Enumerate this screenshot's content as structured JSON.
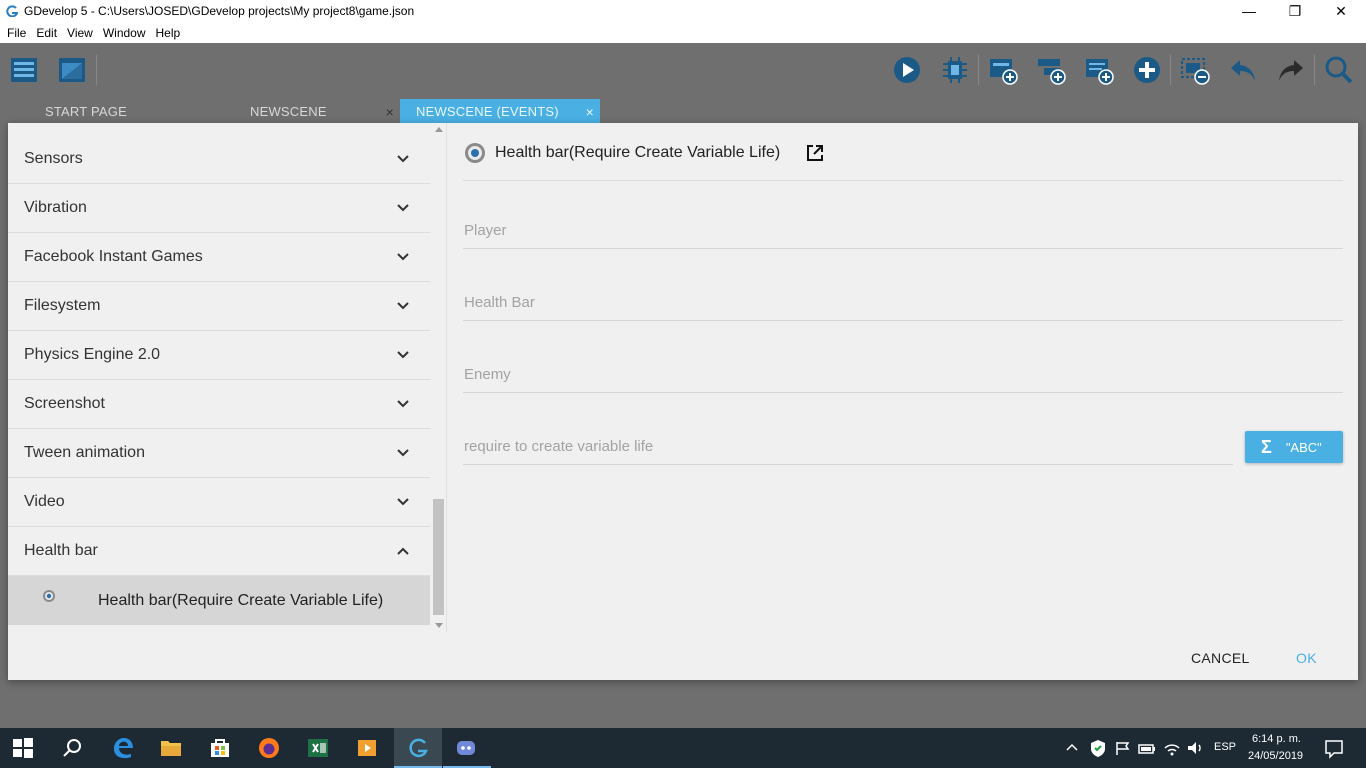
{
  "window": {
    "title": "GDevelop 5 - C:\\Users\\JOSED\\GDevelop projects\\My project8\\game.json",
    "minimize": "—",
    "restore": "❐",
    "close": "✕"
  },
  "menu": [
    "File",
    "Edit",
    "View",
    "Window",
    "Help"
  ],
  "tabs": [
    {
      "label": "START PAGE",
      "closable": false,
      "active": false
    },
    {
      "label": "NEWSCENE",
      "closable": true,
      "active": false
    },
    {
      "label": "NEWSCENE (EVENTS)",
      "closable": true,
      "active": true
    }
  ],
  "tab_close_glyph": "×",
  "extensions": [
    {
      "label": "Sensors",
      "expanded": false
    },
    {
      "label": "Vibration",
      "expanded": false
    },
    {
      "label": "Facebook Instant Games",
      "expanded": false
    },
    {
      "label": "Filesystem",
      "expanded": false
    },
    {
      "label": "Physics Engine 2.0",
      "expanded": false
    },
    {
      "label": "Screenshot",
      "expanded": false
    },
    {
      "label": "Tween animation",
      "expanded": false
    },
    {
      "label": "Video",
      "expanded": false
    },
    {
      "label": "Health bar",
      "expanded": true
    }
  ],
  "selected_instruction": "Health bar(Require Create Variable Life)",
  "instruction": {
    "name": "Health bar(Require Create Variable Life)",
    "params": [
      {
        "placeholder": "Player"
      },
      {
        "placeholder": "Health Bar"
      },
      {
        "placeholder": "Enemy"
      },
      {
        "placeholder": "require to create variable life"
      }
    ],
    "expression_button": {
      "sigma": "Σ",
      "label": "\"ABC\""
    }
  },
  "actions": {
    "cancel": "CANCEL",
    "ok": "OK"
  },
  "taskbar": {
    "language": "ESP",
    "time": "6:14 p. m.",
    "date": "24/05/2019"
  },
  "colors": {
    "accent": "#4ab0e4",
    "toolbar_bg": "#6f6f6f",
    "taskbar_bg": "#1e2a33",
    "toolbar_icon": "#1b5a86"
  },
  "toolbar_icons": [
    "project-manager-icon",
    "scene-icon",
    "preview-play-icon",
    "debugger-icon",
    "add-event-icon",
    "add-subevent-icon",
    "add-comment-icon",
    "add-other-icon",
    "delete-icon",
    "undo-icon",
    "redo-icon",
    "search-icon"
  ]
}
